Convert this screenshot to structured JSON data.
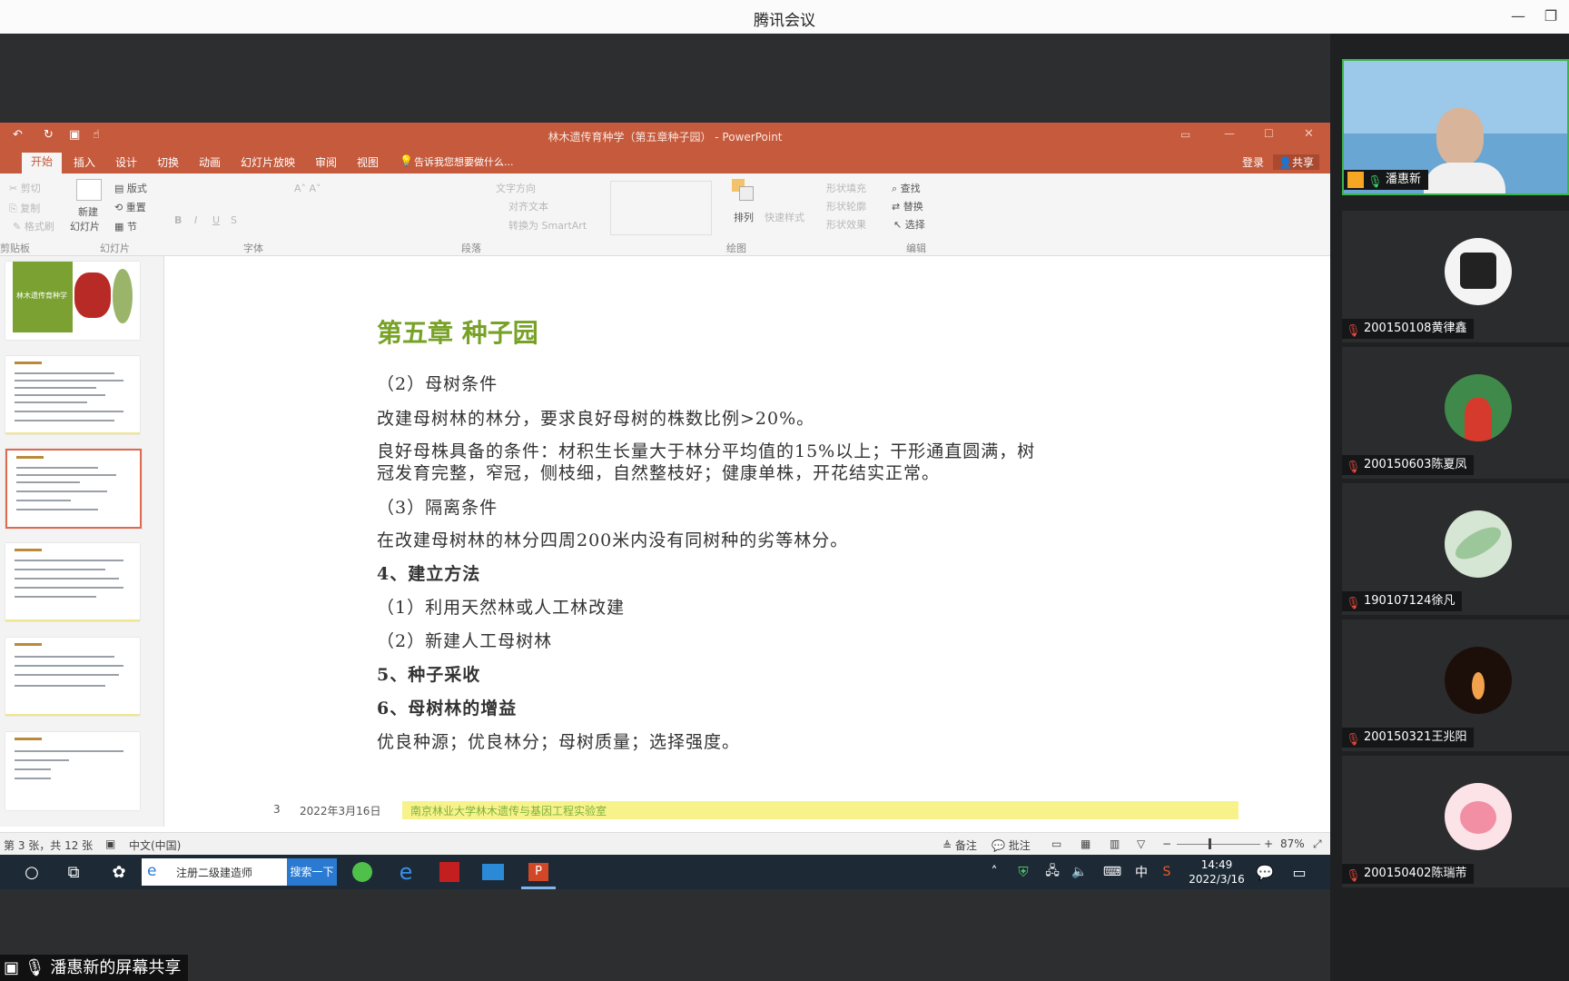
{
  "app": {
    "title": "腾讯会议",
    "share_label": "潘惠新的屏幕共享"
  },
  "ppt": {
    "window_title": "林木遗传育种学（第五章种子园） - PowerPoint",
    "tabs": [
      "开始",
      "插入",
      "设计",
      "切换",
      "动画",
      "幻灯片放映",
      "审阅",
      "视图"
    ],
    "tell_me": "告诉我您想要做什么...",
    "login": "登录",
    "share": "共享",
    "ribbon": {
      "cut": "剪切",
      "copy": "复制",
      "format_painter": "格式刷",
      "new_slide": "新建",
      "new_slide2": "幻灯片",
      "layout": "版式",
      "reset": "重置",
      "section": "节",
      "text_dir": "文字方向",
      "align_text": "对齐文本",
      "smartart": "转换为 SmartArt",
      "arrange": "排列",
      "quick_styles": "快速样式",
      "shape_fill": "形状填充",
      "shape_outline": "形状轮廓",
      "shape_effect": "形状效果",
      "find": "查找",
      "replace": "替换",
      "select": "选择",
      "groups": {
        "clipboard": "剪贴板",
        "slides": "幻灯片",
        "font": "字体",
        "paragraph": "段落",
        "drawing": "绘图",
        "editing": "编辑"
      }
    },
    "thumb1_title": "林木遗传育种学",
    "slide": {
      "title": "第五章  种子园",
      "lines": [
        {
          "text": "（2）母树条件",
          "bold": false
        },
        {
          "text": "改建母树林的林分，要求良好母树的株数比例>20%。",
          "bold": false
        },
        {
          "text": "良好母株具备的条件：材积生长量大于林分平均值的15%以上；干形通直圆满，树",
          "bold": false
        },
        {
          "text": "冠发育完整，窄冠，侧枝细，自然整枝好；健康单株，开花结实正常。",
          "bold": false
        },
        {
          "text": "（3）隔离条件",
          "bold": false
        },
        {
          "text": "在改建母树林的林分四周200米内没有同树种的劣等林分。",
          "bold": false
        },
        {
          "text": "4、建立方法",
          "bold": true
        },
        {
          "text": "（1）利用天然林或人工林改建",
          "bold": false
        },
        {
          "text": "（2）新建人工母树林",
          "bold": false
        },
        {
          "text": "5、种子采收",
          "bold": true
        },
        {
          "text": "6、母树林的增益",
          "bold": true
        },
        {
          "text": "优良种源；优良林分；母树质量；选择强度。",
          "bold": false
        }
      ],
      "footer_num": "3",
      "footer_date": "2022年3月16日",
      "footer_org": "南京林业大学林木遗传与基因工程实验室"
    },
    "status": {
      "slide_info": "第 3 张，共 12 张",
      "lang": "中文(中国)",
      "notes": "备注",
      "comments": "批注",
      "zoom": "87%"
    }
  },
  "taskbar": {
    "search_text": "注册二级建造师",
    "search_btn": "搜索一下",
    "time": "14:49",
    "date": "2022/3/16",
    "ime": "中"
  },
  "participants": [
    {
      "name": "潘惠新",
      "muted": false
    },
    {
      "name": "200150108黄律鑫",
      "muted": true
    },
    {
      "name": "200150603陈夏凤",
      "muted": true
    },
    {
      "name": "190107124徐凡",
      "muted": true
    },
    {
      "name": "200150321王兆阳",
      "muted": true
    },
    {
      "name": "200150402陈瑞芾",
      "muted": true
    }
  ],
  "colors": {
    "ppt_accent": "#c55a3c",
    "slide_title": "#77a225",
    "footer_bar": "#f7f38a"
  }
}
